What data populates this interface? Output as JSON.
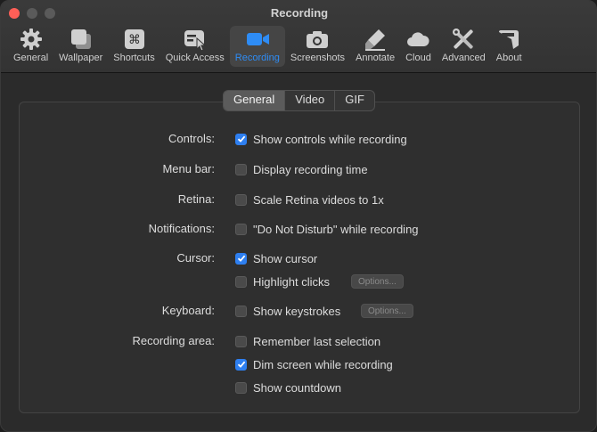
{
  "window": {
    "title": "Recording"
  },
  "toolbar": {
    "items": [
      {
        "label": "General",
        "icon": "gear-icon",
        "active": false
      },
      {
        "label": "Wallpaper",
        "icon": "wallpaper-icon",
        "active": false
      },
      {
        "label": "Shortcuts",
        "icon": "command-key-icon",
        "active": false
      },
      {
        "label": "Quick Access",
        "icon": "quick-access-icon",
        "active": false
      },
      {
        "label": "Recording",
        "icon": "video-camera-icon",
        "active": true
      },
      {
        "label": "Screenshots",
        "icon": "camera-icon",
        "active": false
      },
      {
        "label": "Annotate",
        "icon": "marker-icon",
        "active": false
      },
      {
        "label": "Cloud",
        "icon": "cloud-icon",
        "active": false
      },
      {
        "label": "Advanced",
        "icon": "tools-icon",
        "active": false
      },
      {
        "label": "About",
        "icon": "about-icon",
        "active": false
      }
    ]
  },
  "tabs": [
    {
      "label": "General",
      "active": true
    },
    {
      "label": "Video",
      "active": false
    },
    {
      "label": "GIF",
      "active": false
    }
  ],
  "settings": {
    "controls": {
      "label": "Controls:",
      "show_controls": {
        "label": "Show controls while recording",
        "checked": true
      }
    },
    "menu_bar": {
      "label": "Menu bar:",
      "display_time": {
        "label": "Display recording time",
        "checked": false
      }
    },
    "retina": {
      "label": "Retina:",
      "scale_retina": {
        "label": "Scale Retina videos to 1x",
        "checked": false
      }
    },
    "notifications": {
      "label": "Notifications:",
      "dnd": {
        "label": "\"Do Not Disturb\" while recording",
        "checked": false
      }
    },
    "cursor": {
      "label": "Cursor:",
      "show_cursor": {
        "label": "Show cursor",
        "checked": true
      },
      "highlight_clicks": {
        "label": "Highlight clicks",
        "checked": false,
        "options_label": "Options..."
      }
    },
    "keyboard": {
      "label": "Keyboard:",
      "show_keystrokes": {
        "label": "Show keystrokes",
        "checked": false,
        "options_label": "Options..."
      }
    },
    "recording_area": {
      "label": "Recording area:",
      "remember_selection": {
        "label": "Remember last selection",
        "checked": false
      },
      "dim_screen": {
        "label": "Dim screen while recording",
        "checked": true
      },
      "show_countdown": {
        "label": "Show countdown",
        "checked": false
      }
    }
  },
  "colors": {
    "accent": "#2e8cf5",
    "checkbox_checked": "#2e7ff0",
    "close_button": "#fe5f57"
  }
}
